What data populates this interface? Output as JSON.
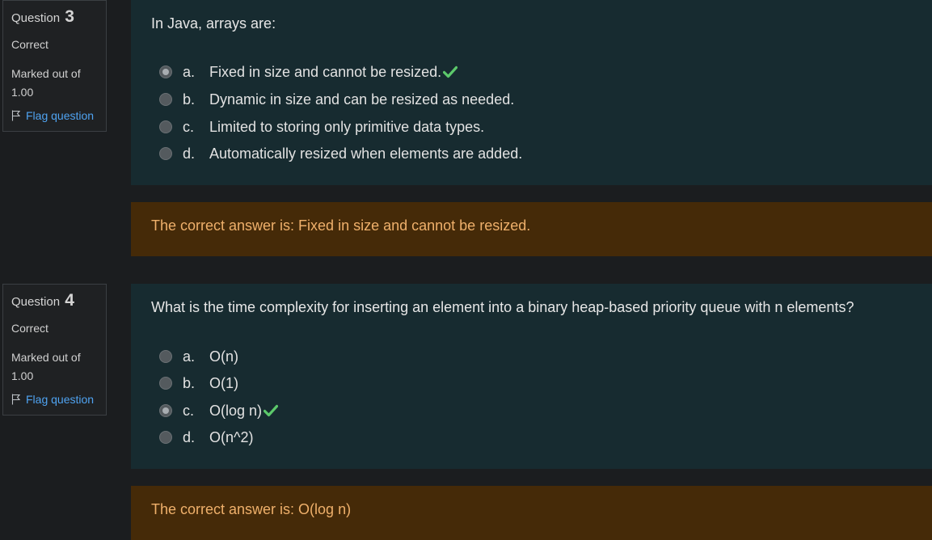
{
  "questions": [
    {
      "label": "Question",
      "number": "3",
      "state": "Correct",
      "grade": "Marked out of 1.00",
      "flag_label": "Flag question",
      "text": "In Java, arrays are:",
      "answers": [
        {
          "letter": "a.",
          "text": "Fixed in size and cannot be resized.",
          "selected": true,
          "correct": true
        },
        {
          "letter": "b.",
          "text": "Dynamic in size and can be resized as needed.",
          "selected": false,
          "correct": false
        },
        {
          "letter": "c.",
          "text": "Limited to storing only primitive data types.",
          "selected": false,
          "correct": false
        },
        {
          "letter": "d.",
          "text": "Automatically resized when elements are added.",
          "selected": false,
          "correct": false
        }
      ],
      "feedback": "The correct answer is: Fixed in size and cannot be resized."
    },
    {
      "label": "Question",
      "number": "4",
      "state": "Correct",
      "grade": "Marked out of 1.00",
      "flag_label": "Flag question",
      "text": "What is the time complexity for inserting an element into a binary heap-based priority queue with n elements?",
      "answers": [
        {
          "letter": "a.",
          "text": "O(n)",
          "selected": false,
          "correct": false
        },
        {
          "letter": "b.",
          "text": "O(1)",
          "selected": false,
          "correct": false
        },
        {
          "letter": "c.",
          "text": "O(log n)",
          "selected": true,
          "correct": true
        },
        {
          "letter": "d.",
          "text": "O(n^2)",
          "selected": false,
          "correct": false
        }
      ],
      "feedback": "The correct answer is: O(log n)"
    }
  ],
  "colors": {
    "background": "#1b1d1f",
    "content_bg": "#172b30",
    "feedback_bg": "#452a08",
    "feedback_text": "#efb06b",
    "link": "#4fa3f1",
    "check": "#5cc96b"
  }
}
